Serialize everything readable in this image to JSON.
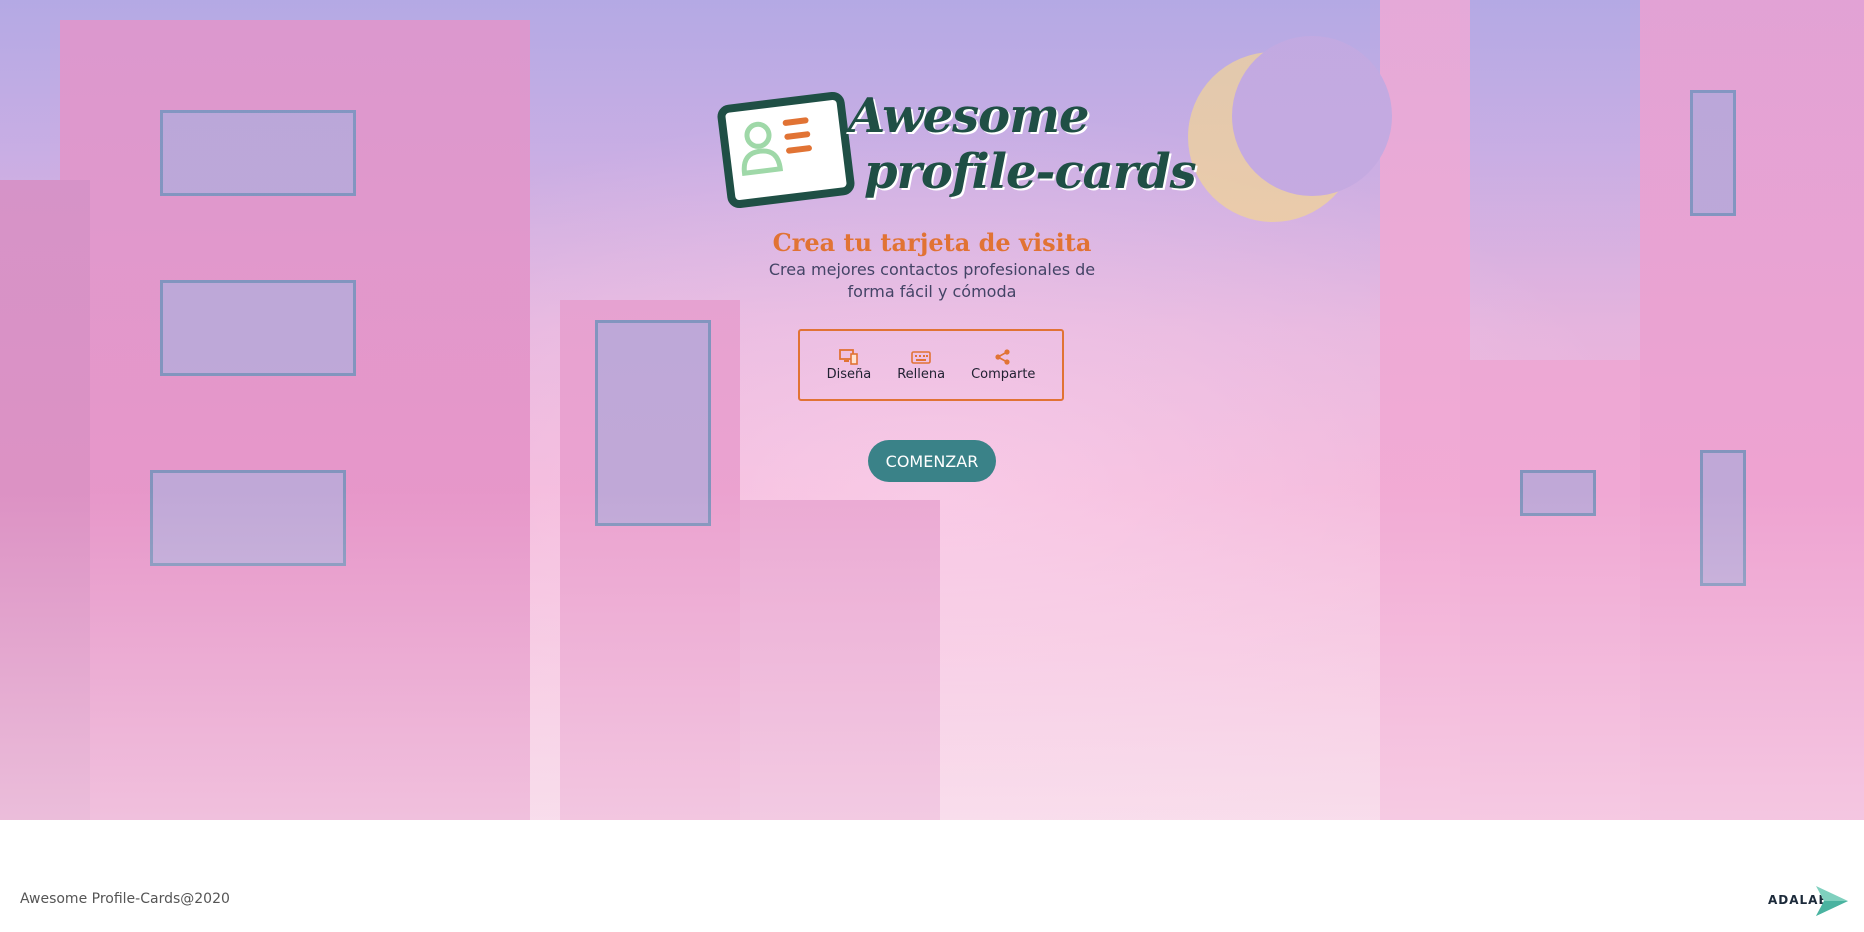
{
  "header": {
    "logo": {
      "line1": "Awesome",
      "line2": "profile-cards"
    },
    "headline": "Crea tu tarjeta de visita",
    "subline_1": "Crea mejores contactos profesionales de",
    "subline_2": "forma fácil y cómoda"
  },
  "steps": [
    {
      "label": "Diseña",
      "icon": "design-devices-icon"
    },
    {
      "label": "Rellena",
      "icon": "keyboard-icon"
    },
    {
      "label": "Comparte",
      "icon": "share-icon"
    }
  ],
  "cta": {
    "label": "COMENZAR"
  },
  "footer": {
    "copyright": "Awesome Profile-Cards@2020",
    "brand": "ADALAB"
  },
  "colors": {
    "accent_orange": "#e17334",
    "logo_green": "#1f4f45",
    "button_teal": "#3a8288"
  }
}
